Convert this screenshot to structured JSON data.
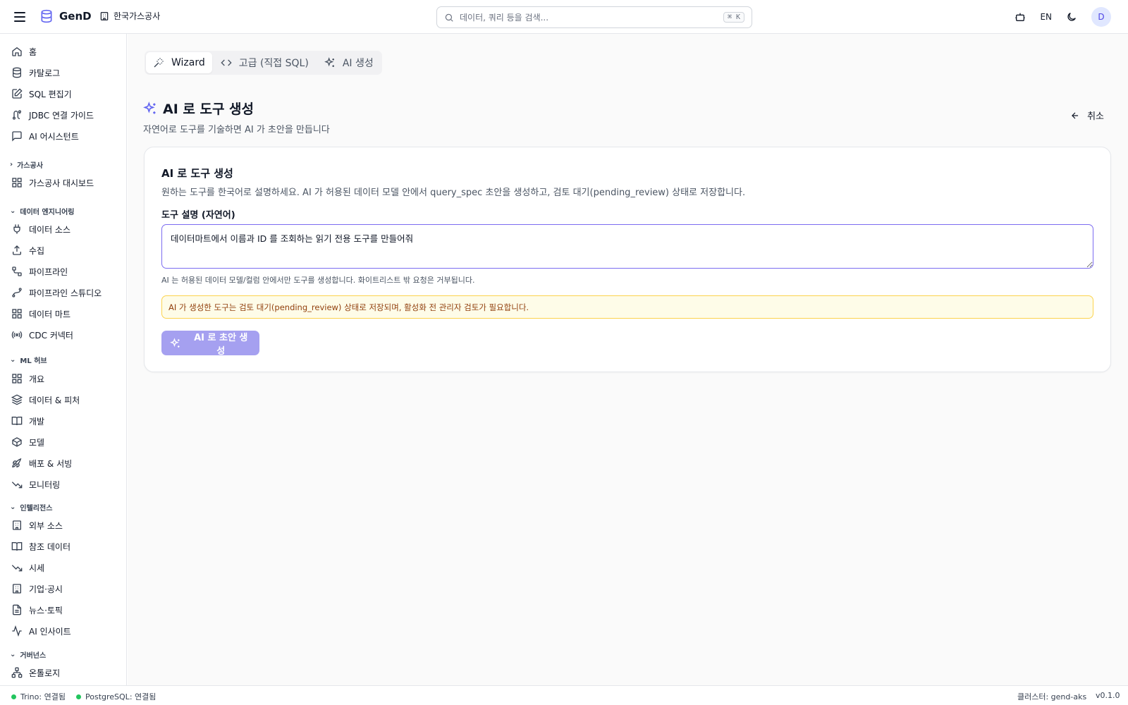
{
  "app": {
    "name": "GenD",
    "org": "한국가스공사"
  },
  "search": {
    "placeholder": "데이터, 쿼리 등을 검색...",
    "shortcut": "⌘ K"
  },
  "header": {
    "lang": "EN",
    "avatar": "D"
  },
  "sidebar": {
    "top_items": [
      {
        "label": "홈",
        "icon": "home-icon"
      },
      {
        "label": "카탈로그",
        "icon": "database-icon"
      },
      {
        "label": "SQL 편집기",
        "icon": "edit-icon"
      },
      {
        "label": "JDBC 연결 가이드",
        "icon": "plug-route-icon"
      },
      {
        "label": "AI 어시스턴트",
        "icon": "message-icon"
      }
    ],
    "sections": [
      {
        "label": "가스공사",
        "collapsed": true,
        "items": [
          {
            "label": "가스공사 대시보드",
            "icon": "dashboard-icon"
          }
        ]
      },
      {
        "label": "데이터 엔지니어링",
        "items": [
          {
            "label": "데이터 소스",
            "icon": "plug-icon"
          },
          {
            "label": "수집",
            "icon": "upload-icon"
          },
          {
            "label": "파이프라인",
            "icon": "workflow-icon"
          },
          {
            "label": "파이프라인 스튜디오",
            "icon": "spline-icon"
          },
          {
            "label": "데이터 마트",
            "icon": "grid-icon"
          },
          {
            "label": "CDC 커넥터",
            "icon": "radio-icon"
          }
        ]
      },
      {
        "label": "ML 허브",
        "items": [
          {
            "label": "개요",
            "icon": "grid-icon"
          },
          {
            "label": "데이터 & 피처",
            "icon": "layers-icon"
          },
          {
            "label": "개발",
            "icon": "book-icon"
          },
          {
            "label": "모델",
            "icon": "box-icon"
          },
          {
            "label": "배포 & 서빙",
            "icon": "rocket-icon"
          },
          {
            "label": "모니터링",
            "icon": "trending-down-icon"
          }
        ]
      },
      {
        "label": "인텔리전스",
        "items": [
          {
            "label": "외부 소스",
            "icon": "building-icon"
          },
          {
            "label": "참조 데이터",
            "icon": "book-icon"
          },
          {
            "label": "시세",
            "icon": "trending-down-icon"
          },
          {
            "label": "기업·공시",
            "icon": "building-icon"
          },
          {
            "label": "뉴스·토픽",
            "icon": "file-icon"
          },
          {
            "label": "AI 인사이트",
            "icon": "activity-icon"
          }
        ]
      },
      {
        "label": "거버넌스",
        "items": [
          {
            "label": "온톨로지",
            "icon": "network-icon"
          }
        ]
      }
    ]
  },
  "tabs": [
    {
      "label": "Wizard",
      "icon": "wand-icon",
      "active": true
    },
    {
      "label": "고급 (직접 SQL)",
      "icon": "code-icon",
      "active": false
    },
    {
      "label": "AI 생성",
      "icon": "sparkles-icon",
      "active": false
    }
  ],
  "page": {
    "title": "AI 로 도구 생성",
    "subtitle": "자연어로 도구를 기술하면 AI 가 초안을 만듭니다",
    "cancel": "취소"
  },
  "card": {
    "title": "AI 로 도구 생성",
    "desc": "원하는 도구를 한국어로 설명하세요. AI 가 허용된 데이터 모델 안에서 query_spec 초안을 생성하고, 검토 대기(pending_review) 상태로 저장합니다.",
    "field_label": "도구 설명 (자연어)",
    "textarea_value": "데이터마트에서 이름과 ID 를 조회하는 읽기 전용 도구를 만들어줘",
    "hint": "AI 는 허용된 데이터 모델/컬럼 안에서만 도구를 생성합니다. 화이트리스트 밖 요청은 거부됩니다.",
    "warning": "AI 가 생성한 도구는 검토 대기(pending_review) 상태로 저장되며, 활성화 전 관리자 검토가 필요합니다.",
    "button": "AI 로 초안 생성"
  },
  "status": {
    "trino": "Trino: 연결됨",
    "postgres": "PostgreSQL: 연결됨",
    "cluster": "클러스터: gend-aks",
    "version": "v0.1.0"
  },
  "colors": {
    "accent": "#6366f1",
    "ok": "#22c55e",
    "warn_bg": "#fefce8",
    "warn_border": "#fcd34d"
  }
}
